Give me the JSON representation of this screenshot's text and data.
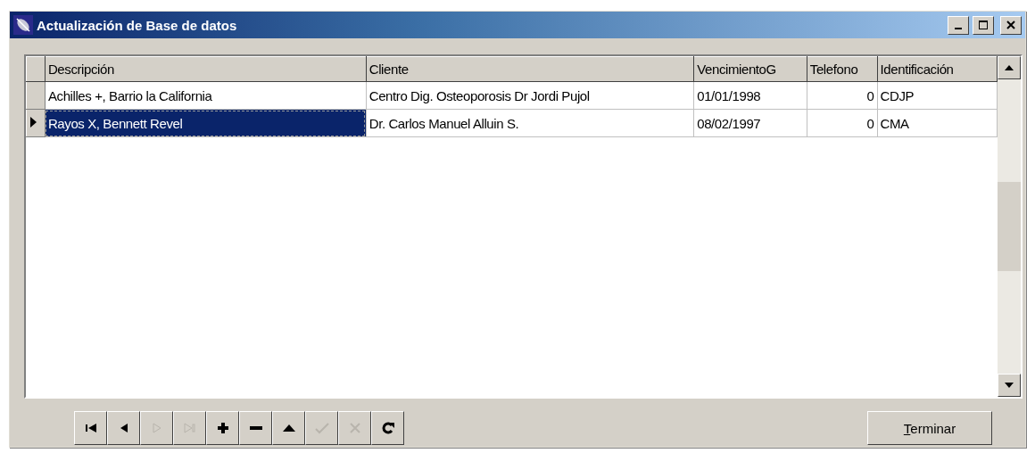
{
  "window": {
    "title": "Actualización de Base de datos"
  },
  "table": {
    "columns": [
      {
        "label": "Descripción",
        "kind": "text"
      },
      {
        "label": "Cliente",
        "kind": "text"
      },
      {
        "label": "VencimientoG",
        "kind": "text"
      },
      {
        "label": "Telefono",
        "kind": "number"
      },
      {
        "label": "Identificación",
        "kind": "text"
      }
    ],
    "rows": [
      {
        "selected": false,
        "cells": [
          "Achilles +, Barrio la California",
          "Centro Dig. Osteoporosis Dr Jordi Pujol",
          "01/01/1998",
          "0",
          "CDJP"
        ]
      },
      {
        "selected": true,
        "cells": [
          "Rayos X, Bennett Revel",
          "Dr. Carlos Manuel Alluin S.",
          "08/02/1997",
          "0",
          "CMA"
        ]
      }
    ]
  },
  "navigator": [
    {
      "kind": "first",
      "disabled": false
    },
    {
      "kind": "prior",
      "disabled": false
    },
    {
      "kind": "next",
      "disabled": true
    },
    {
      "kind": "last",
      "disabled": true
    },
    {
      "kind": "insert",
      "disabled": false
    },
    {
      "kind": "delete",
      "disabled": false
    },
    {
      "kind": "edit",
      "disabled": false
    },
    {
      "kind": "post",
      "disabled": true
    },
    {
      "kind": "cancel",
      "disabled": true
    },
    {
      "kind": "refresh",
      "disabled": false
    }
  ],
  "finish_button": {
    "label": "Terminar",
    "mnemonic_underlined": true
  }
}
